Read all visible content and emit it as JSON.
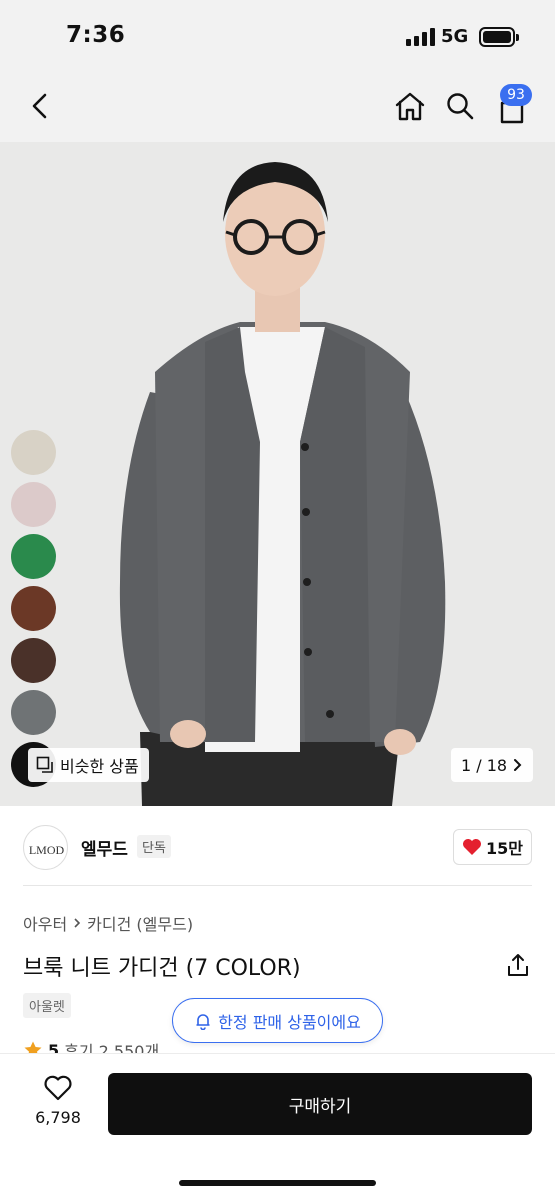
{
  "status_bar": {
    "time": "7:36",
    "network": "5G"
  },
  "nav": {
    "cart_count": "93"
  },
  "hero": {
    "swatch_colors": [
      "#d8d2c6",
      "#dccaca",
      "#2a8a4c",
      "#6b3826",
      "#4a3129",
      "#6f7375",
      "#111111"
    ],
    "similar_label": "비슷한 상품",
    "page_indicator": "1 / 18"
  },
  "brand": {
    "logo_text": "LMOD",
    "name": "엘무드",
    "badge": "단독",
    "likes": "15만"
  },
  "product": {
    "breadcrumb": [
      "아우터",
      "카디건 (엘무드)"
    ],
    "title": "브룩 니트 가디건 (7 COLOR)",
    "tag": "아울렛",
    "rating": "5",
    "reviews": "후기 2,550개",
    "limited_notice": "한정 판매 상품이에요"
  },
  "bottom": {
    "wish_count": "6,798",
    "buy_label": "구매하기"
  }
}
